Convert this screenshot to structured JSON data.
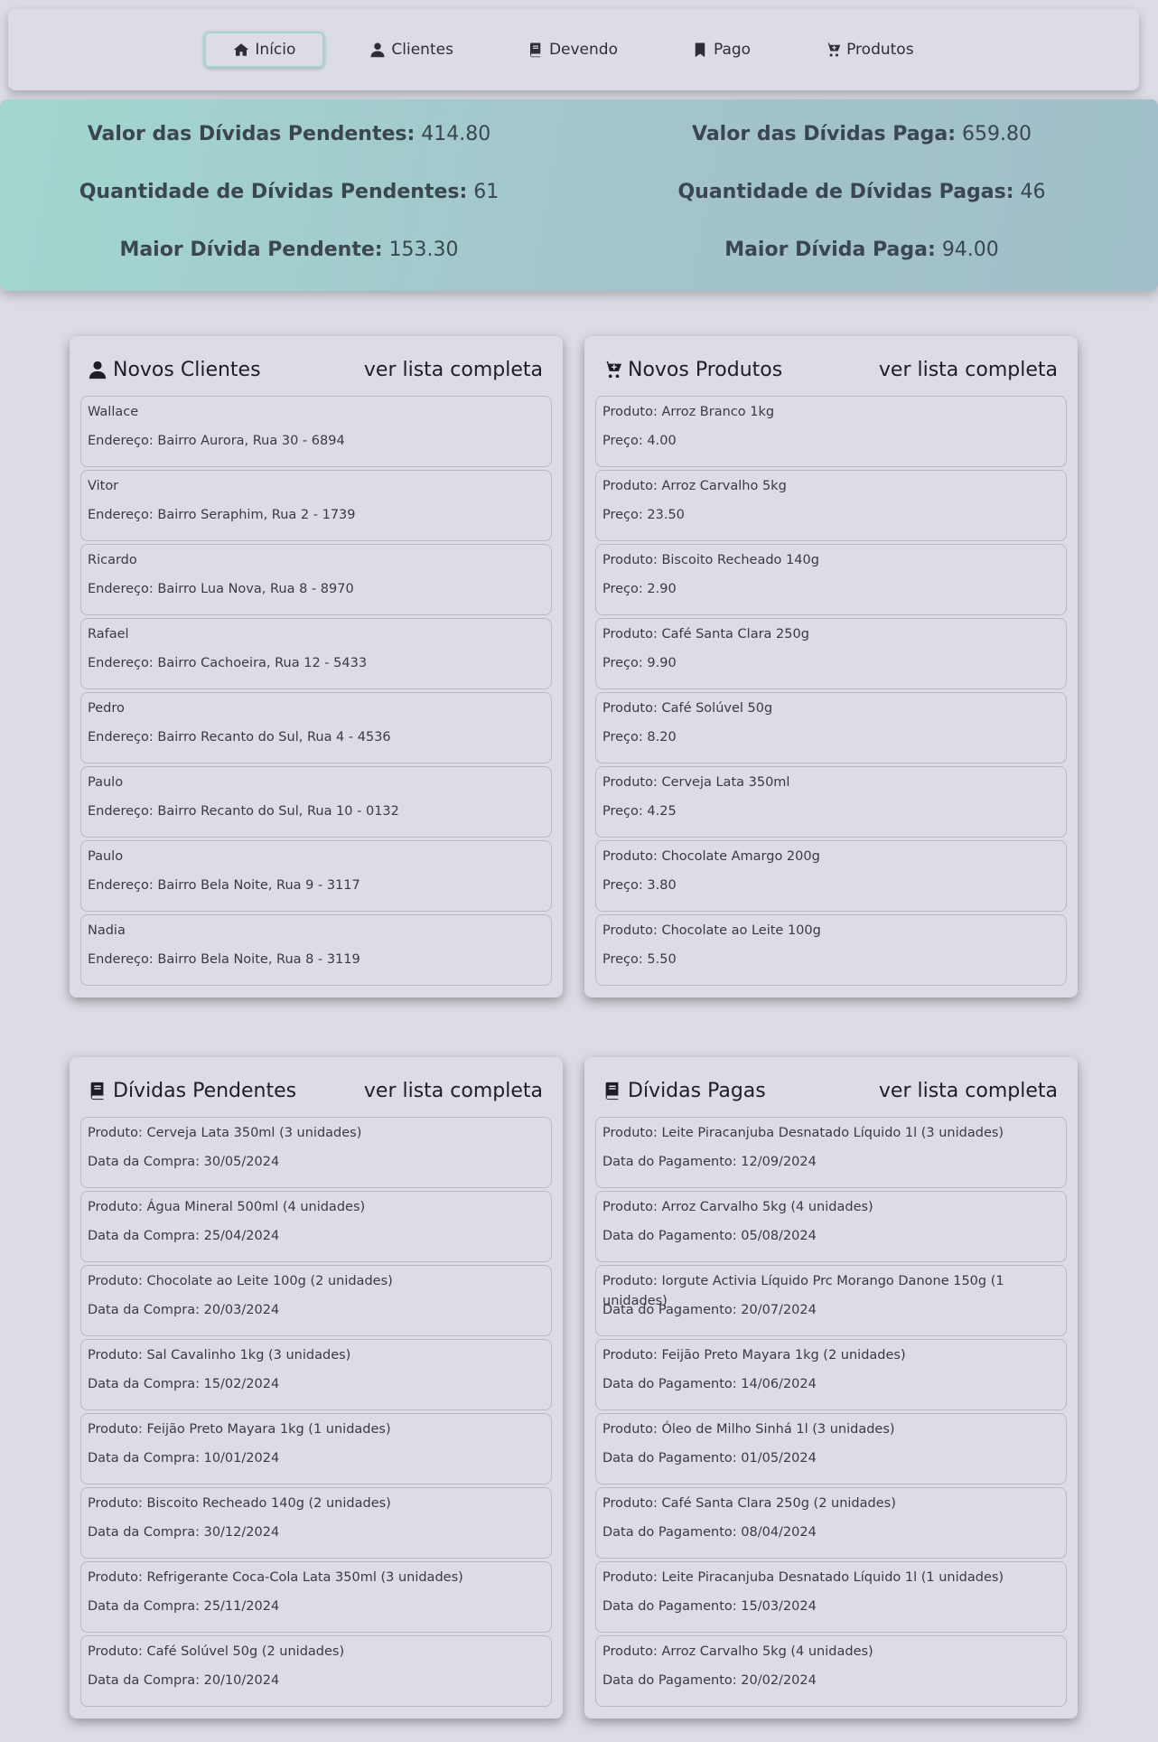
{
  "nav": [
    {
      "label": "Início",
      "icon": "home-icon",
      "active": true
    },
    {
      "label": "Clientes",
      "icon": "user-icon",
      "active": false
    },
    {
      "label": "Devendo",
      "icon": "book-icon",
      "active": false
    },
    {
      "label": "Pago",
      "icon": "bookmark-icon",
      "active": false
    },
    {
      "label": "Produtos",
      "icon": "cart-plus-icon",
      "active": false
    }
  ],
  "stats": {
    "pending_value_label": "Valor das Dívidas Pendentes:",
    "pending_value": "414.80",
    "paid_value_label": "Valor das Dívidas Paga:",
    "paid_value": "659.80",
    "pending_count_label": "Quantidade de Dívidas Pendentes:",
    "pending_count": "61",
    "paid_count_label": "Quantidade de Dívidas Pagas:",
    "paid_count": "46",
    "pending_max_label": "Maior Dívida Pendente:",
    "pending_max": "153.30",
    "paid_max_label": "Maior Dívida Paga:",
    "paid_max": "94.00"
  },
  "cards": {
    "clients": {
      "title": "Novos Clientes",
      "link": "ver lista completa",
      "items": [
        {
          "l1": "Wallace",
          "l2": "Endereço: Bairro Aurora, Rua 30 - 6894"
        },
        {
          "l1": "Vitor",
          "l2": "Endereço: Bairro Seraphim, Rua 2 - 1739"
        },
        {
          "l1": "Ricardo",
          "l2": "Endereço: Bairro Lua Nova, Rua 8 - 8970"
        },
        {
          "l1": "Rafael",
          "l2": "Endereço: Bairro Cachoeira, Rua 12 - 5433"
        },
        {
          "l1": "Pedro",
          "l2": "Endereço: Bairro Recanto do Sul, Rua 4 - 4536"
        },
        {
          "l1": "Paulo",
          "l2": "Endereço: Bairro Recanto do Sul, Rua 10 - 0132"
        },
        {
          "l1": "Paulo",
          "l2": "Endereço: Bairro Bela Noite, Rua 9 - 3117"
        },
        {
          "l1": "Nadia",
          "l2": "Endereço: Bairro Bela Noite, Rua 8 - 3119"
        }
      ]
    },
    "products": {
      "title": "Novos Produtos",
      "link": "ver lista completa",
      "items": [
        {
          "l1": "Produto: Arroz Branco 1kg",
          "l2": "Preço: 4.00"
        },
        {
          "l1": "Produto: Arroz Carvalho 5kg",
          "l2": "Preço: 23.50"
        },
        {
          "l1": "Produto: Biscoito Recheado 140g",
          "l2": "Preço: 2.90"
        },
        {
          "l1": "Produto: Café Santa Clara 250g",
          "l2": "Preço: 9.90"
        },
        {
          "l1": "Produto: Café Solúvel 50g",
          "l2": "Preço: 8.20"
        },
        {
          "l1": "Produto: Cerveja Lata 350ml",
          "l2": "Preço: 4.25"
        },
        {
          "l1": "Produto: Chocolate Amargo 200g",
          "l2": "Preço: 3.80"
        },
        {
          "l1": "Produto: Chocolate ao Leite 100g",
          "l2": "Preço: 5.50"
        }
      ]
    },
    "pending": {
      "title": "Dívidas Pendentes",
      "link": "ver lista completa",
      "items": [
        {
          "l1": "Produto: Cerveja Lata 350ml (3 unidades)",
          "l2": "Data da Compra: 30/05/2024"
        },
        {
          "l1": "Produto: Água Mineral 500ml (4 unidades)",
          "l2": "Data da Compra: 25/04/2024"
        },
        {
          "l1": "Produto: Chocolate ao Leite 100g (2 unidades)",
          "l2": "Data da Compra: 20/03/2024"
        },
        {
          "l1": "Produto: Sal Cavalinho 1kg (3 unidades)",
          "l2": "Data da Compra: 15/02/2024"
        },
        {
          "l1": "Produto: Feijão Preto Mayara 1kg (1 unidades)",
          "l2": "Data da Compra: 10/01/2024"
        },
        {
          "l1": "Produto: Biscoito Recheado 140g (2 unidades)",
          "l2": "Data da Compra: 30/12/2024"
        },
        {
          "l1": "Produto: Refrigerante Coca-Cola Lata 350ml (3 unidades)",
          "l2": "Data da Compra: 25/11/2024"
        },
        {
          "l1": "Produto: Café Solúvel 50g (2 unidades)",
          "l2": "Data da Compra: 20/10/2024"
        }
      ]
    },
    "paid": {
      "title": "Dívidas Pagas",
      "link": "ver lista completa",
      "items": [
        {
          "l1": "Produto: Leite Piracanjuba Desnatado Líquido 1l (3 unidades)",
          "l2": "Data do Pagamento: 12/09/2024"
        },
        {
          "l1": "Produto: Arroz Carvalho 5kg (4 unidades)",
          "l2": "Data do Pagamento: 05/08/2024"
        },
        {
          "l1": "Produto: Iorgute Activia Líquido Prc Morango Danone 150g (1 unidades)",
          "l2": "Data do Pagamento: 20/07/2024"
        },
        {
          "l1": "Produto: Feijão Preto Mayara 1kg (2 unidades)",
          "l2": "Data do Pagamento: 14/06/2024"
        },
        {
          "l1": "Produto: Óleo de Milho Sinhá 1l (3 unidades)",
          "l2": "Data do Pagamento: 01/05/2024"
        },
        {
          "l1": "Produto: Café Santa Clara 250g (2 unidades)",
          "l2": "Data do Pagamento: 08/04/2024"
        },
        {
          "l1": "Produto: Leite Piracanjuba Desnatado Líquido 1l (1 unidades)",
          "l2": "Data do Pagamento: 15/03/2024"
        },
        {
          "l1": "Produto: Arroz Carvalho 5kg (4 unidades)",
          "l2": "Data do Pagamento: 20/02/2024"
        }
      ]
    }
  }
}
